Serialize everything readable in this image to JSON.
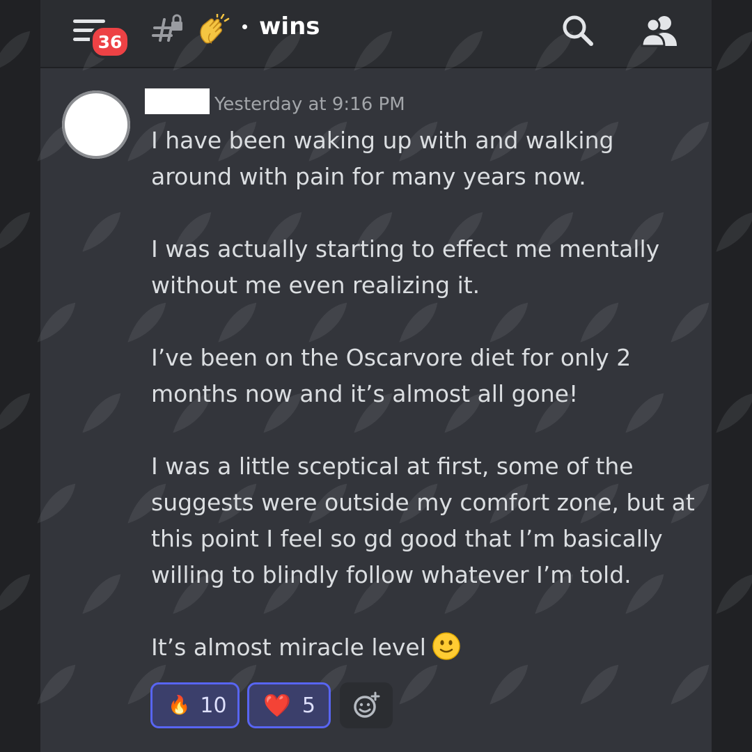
{
  "header": {
    "unread_count": "36",
    "channel_emoji": "👏",
    "channel_name": "wins"
  },
  "message": {
    "timestamp": "Yesterday at 9:16 PM",
    "paragraphs": [
      "I have been waking up with and walking around with pain for many years now.",
      "I was actually starting to effect me mentally without me even realizing it.",
      "I’ve been on the Oscarvore diet for only 2 months now and it’s almost all gone!",
      "I was a little sceptical at first, some of the suggests were outside my comfort zone, but at this point I feel so gd good that I’m basically willing to blindly follow whatever I’m told.",
      "It’s almost miracle level"
    ]
  },
  "reactions": [
    {
      "emoji": "🔥",
      "count": "10"
    },
    {
      "emoji": "❤️",
      "count": "5"
    }
  ],
  "icons": {
    "menu": "hamburger-icon",
    "channel": "locked-channel-icon",
    "search": "search-icon",
    "members": "members-icon",
    "add_reaction": "add-reaction-icon",
    "inline_emoji": "slight-smile-emoji"
  },
  "colors": {
    "badge": "#ed4245",
    "reaction_border": "#5865f2",
    "background": "#33353b"
  }
}
